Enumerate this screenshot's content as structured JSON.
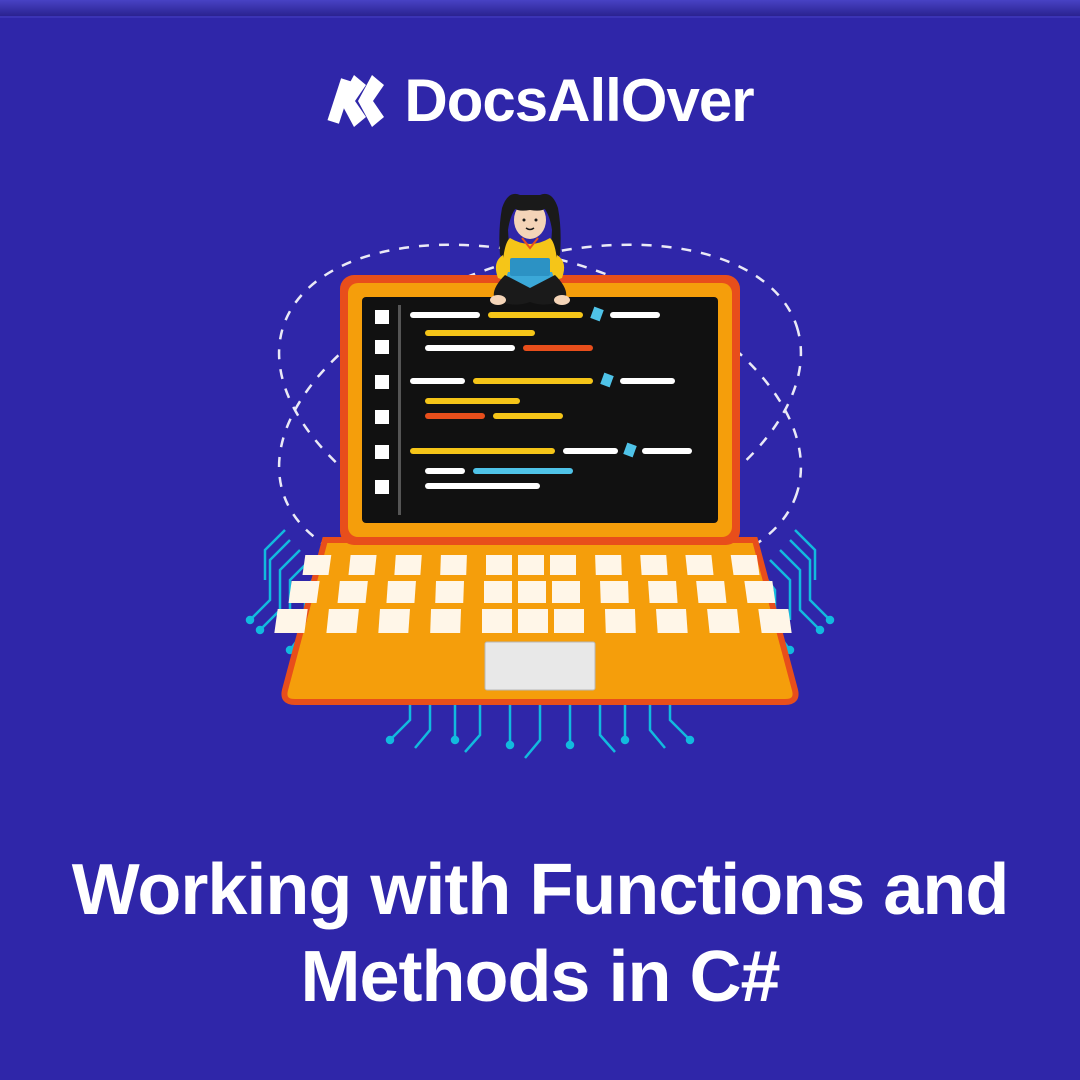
{
  "brand": {
    "name": "DocsAllOver",
    "icon": "logo-mark"
  },
  "title": "Working with Functions and Methods in C#",
  "colors": {
    "background": "#2f26a9",
    "laptop_body": "#f59e0b",
    "laptop_frame": "#e84e1b",
    "screen": "#111111",
    "circuit": "#0ed4e8",
    "text": "#ffffff",
    "code_white": "#ffffff",
    "code_yellow": "#f5c518",
    "code_cyan": "#4fc3e8",
    "code_orange": "#e84e1b"
  }
}
